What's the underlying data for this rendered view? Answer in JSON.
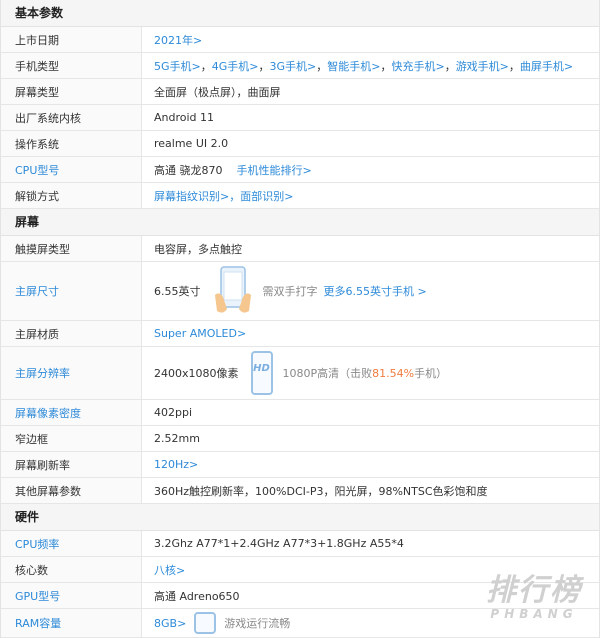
{
  "sections": {
    "basic": "基本参数",
    "screen": "屏幕",
    "hardware": "硬件"
  },
  "rows": {
    "launch_date": {
      "label": "上市日期",
      "value": "2021年>"
    },
    "phone_type": {
      "label": "手机类型",
      "items": [
        "5G手机>",
        "4G手机>",
        "3G手机>",
        "智能手机>",
        "快充手机>",
        "游戏手机>",
        "曲屏手机>"
      ]
    },
    "screen_type": {
      "label": "屏幕类型",
      "value": "全面屏（极点屏），曲面屏"
    },
    "os_factory": {
      "label": "出厂系统内核",
      "value": "Android 11"
    },
    "os": {
      "label": "操作系统",
      "value": "realme UI 2.0"
    },
    "cpu_model": {
      "label": "CPU型号",
      "value": "高通 骁龙870",
      "link": "手机性能排行>"
    },
    "unlock": {
      "label": "解锁方式",
      "value": "屏幕指纹识别>，面部识别>"
    },
    "touch_type": {
      "label": "触摸屏类型",
      "value": "电容屏，多点触控"
    },
    "main_size": {
      "label": "主屏尺寸",
      "value": "6.55英寸",
      "note": "需双手打字",
      "link": "更多6.55英寸手机 >"
    },
    "material": {
      "label": "主屏材质",
      "value": "Super AMOLED>"
    },
    "resolution": {
      "label": "主屏分辨率",
      "value": "2400x1080像素",
      "note_pre": "1080P高清（击败",
      "note_pct": "81.54%",
      "note_post": "手机）",
      "hd": "HD"
    },
    "ppi": {
      "label": "屏幕像素密度",
      "value": "402ppi"
    },
    "bezel": {
      "label": "窄边框",
      "value": "2.52mm"
    },
    "refresh": {
      "label": "屏幕刷新率",
      "value": "120Hz>"
    },
    "other_screen": {
      "label": "其他屏幕参数",
      "value": "360Hz触控刷新率，100%DCI-P3，阳光屏，98%NTSC色彩饱和度"
    },
    "cpu_freq": {
      "label": "CPU频率",
      "value": "3.2Ghz A77*1+2.4GHz A77*3+1.8GHz A55*4"
    },
    "cores": {
      "label": "核心数",
      "value": "八核>"
    },
    "gpu": {
      "label": "GPU型号",
      "value": "高通 Adreno650"
    },
    "ram": {
      "label": "RAM容量",
      "value": "8GB>",
      "note": "游戏运行流畅"
    }
  },
  "watermark": {
    "cn": "排行榜",
    "en": "PHBANG"
  },
  "colors": {
    "link": "#2d8ad8",
    "highlight": "#f07b3f",
    "section_bg": "#f5f5f5"
  }
}
